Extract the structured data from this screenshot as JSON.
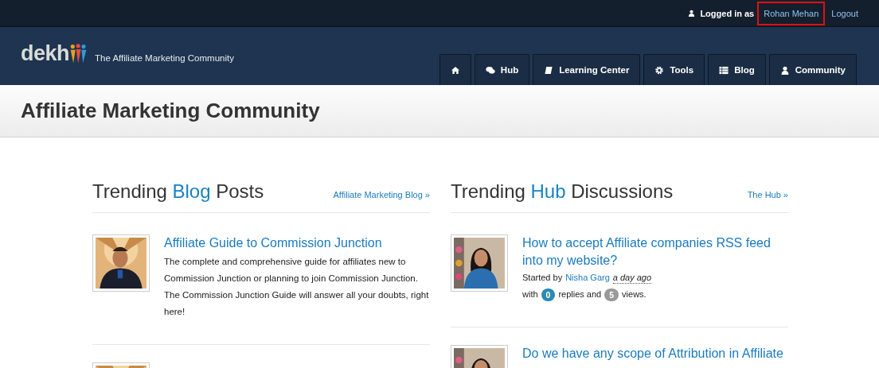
{
  "top_bar": {
    "logged_in_label": "Logged in as",
    "user_name": "Rohan Mehan",
    "user_highlighted": true,
    "logout": "Logout"
  },
  "header": {
    "logo_text": "dekh",
    "tagline": "The Affiliate Marketing Community",
    "nav": [
      {
        "kind": "home"
      },
      {
        "kind": "hub",
        "label": "Hub"
      },
      {
        "kind": "learning",
        "label": "Learning Center"
      },
      {
        "kind": "tools",
        "label": "Tools"
      },
      {
        "kind": "blog",
        "label": "Blog"
      },
      {
        "kind": "community",
        "label": "Community"
      }
    ]
  },
  "page_title": "Affiliate Marketing Community",
  "sections": [
    {
      "heading": "Trending **Blog** Posts",
      "link": "Affiliate Marketing Blog »",
      "items": [
        {
          "kind": "blog",
          "title": "Affiliate Guide to Commission Junction",
          "text": "The complete and comprehensive guide for affiliates new to Commission Junction or planning to join Commission Junction. The Commission Junction Guide will answer all your doubts, right here!"
        },
        {
          "kind": "blog"
        }
      ]
    },
    {
      "heading": "Trending **Hub** Discussions",
      "link": "The Hub »",
      "items": [
        {
          "kind": "discussion",
          "title": "How to accept Affiliate companies RSS feed into my website?",
          "started_by": "Started by",
          "author": "Nisha Garg",
          "time": "a day ago",
          "with": "with",
          "replies": "0",
          "replies_label": "replies and",
          "views": "5",
          "views_label": "views."
        },
        {
          "kind": "discussion",
          "title": "Do we have any scope of Attribution in Affiliate"
        }
      ]
    }
  ]
}
